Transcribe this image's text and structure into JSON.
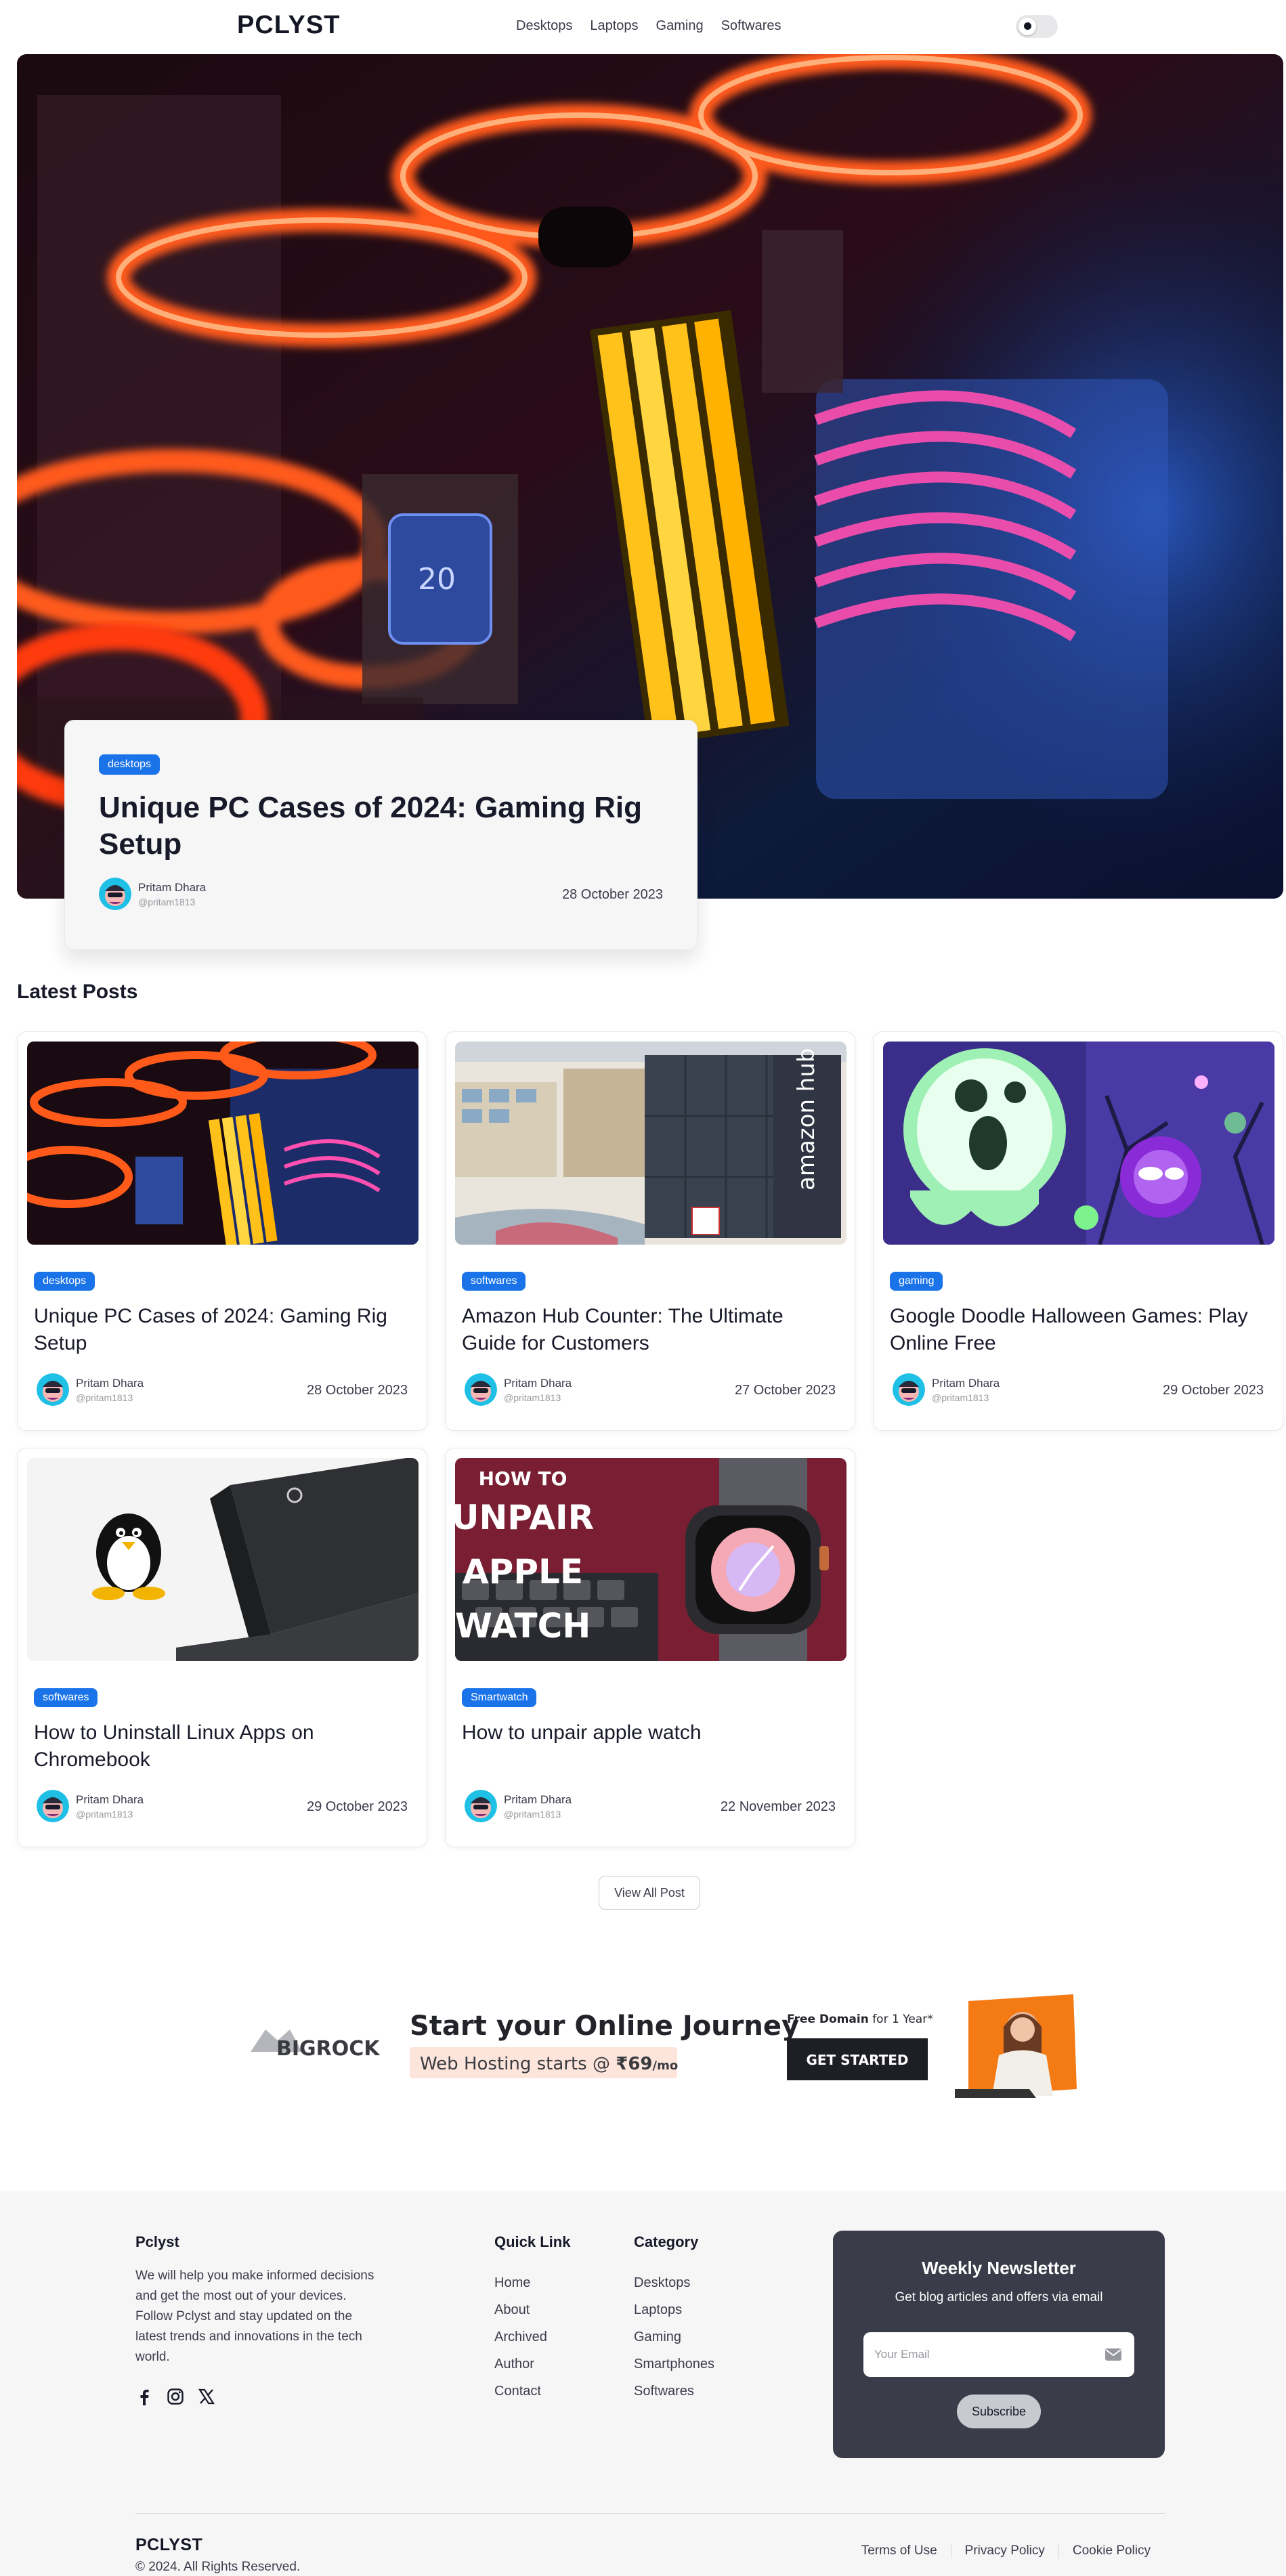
{
  "nav": {
    "brand": "PCLYST",
    "links": [
      "Desktops",
      "Laptops",
      "Gaming",
      "Softwares"
    ],
    "theme_toggle_icon": "moon-icon"
  },
  "hero": {
    "tag": "desktops",
    "title": "Unique PC Cases of 2024: Gaming Rig Setup",
    "author": "Pritam Dhara",
    "handle": "@pritam1813",
    "date": "28 October 2023"
  },
  "latest": {
    "heading": "Latest Posts",
    "posts": [
      {
        "tag": "desktops",
        "title": "Unique PC Cases of 2024: Gaming Rig Setup",
        "author": "Pritam Dhara",
        "handle": "@pritam1813",
        "date": "28 October 2023"
      },
      {
        "tag": "softwares",
        "title": "Amazon Hub Counter: The Ultimate Guide for Customers",
        "author": "Pritam Dhara",
        "handle": "@pritam1813",
        "date": "27 October 2023",
        "image_text": "amazon hub"
      },
      {
        "tag": "gaming",
        "title": "Google Doodle Halloween Games: Play Online Free",
        "author": "Pritam Dhara",
        "handle": "@pritam1813",
        "date": "29 October 2023"
      },
      {
        "tag": "softwares",
        "title": "How to Uninstall Linux Apps on Chromebook",
        "author": "Pritam Dhara",
        "handle": "@pritam1813",
        "date": "29 October 2023"
      },
      {
        "tag": "Smartwatch",
        "title": "How to unpair apple watch",
        "author": "Pritam Dhara",
        "handle": "@pritam1813",
        "date": "22 November 2023",
        "image_lines": [
          "HOW TO",
          "UNPAIR",
          "APPLE",
          "WATCH"
        ]
      }
    ],
    "view_all": "View All Post"
  },
  "ad": {
    "logo": "BIGROCK",
    "headline": "Start your Online Journey",
    "sub_prefix": "Web Hosting starts @ ",
    "price": "₹69",
    "price_suffix": "/mo",
    "promo_bold": "Free Domain",
    "promo_rest": " for 1 Year*",
    "cta": "GET STARTED"
  },
  "footer": {
    "about_title": "Pclyst",
    "about_text": "We will help you make informed decisions and get the most out of your devices. Follow Pclyst and stay updated on the latest trends and innovations in the tech world.",
    "social_icons": [
      "facebook-icon",
      "instagram-icon",
      "x-icon"
    ],
    "quick_title": "Quick Link",
    "quick_links": [
      "Home",
      "About",
      "Archived",
      "Author",
      "Contact"
    ],
    "category_title": "Category",
    "categories": [
      "Desktops",
      "Laptops",
      "Gaming",
      "Smartphones",
      "Softwares"
    ],
    "newsletter": {
      "title": "Weekly Newsletter",
      "subtitle": "Get blog articles and offers via email",
      "placeholder": "Your Email",
      "button": "Subscribe"
    },
    "brand": "PCLYST",
    "copyright": "© 2024. All Rights Reserved.",
    "legal": [
      "Terms of Use",
      "Privacy Policy",
      "Cookie Policy"
    ]
  },
  "colors": {
    "accent": "#1a73e8",
    "newsletter_bg": "#3b3c4a",
    "footer_bg": "#f6f6f7"
  }
}
